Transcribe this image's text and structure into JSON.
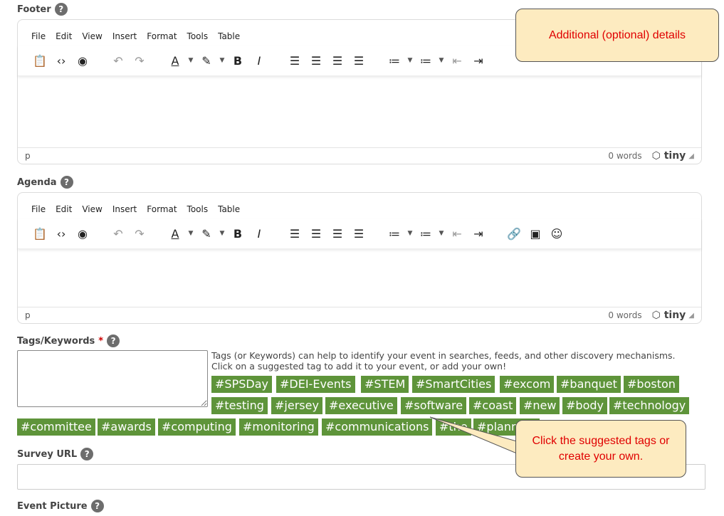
{
  "footer": {
    "label": "Footer",
    "help": "?"
  },
  "agenda": {
    "label": "Agenda",
    "help": "?"
  },
  "editor": {
    "menus": [
      "File",
      "Edit",
      "View",
      "Insert",
      "Format",
      "Tools",
      "Table"
    ],
    "path": "p",
    "word_count": "0 words",
    "brand": "tiny"
  },
  "tags": {
    "label": "Tags/Keywords",
    "required_mark": "*",
    "help": "?",
    "help_line1": "Tags (or Keywords) can help to identify your event in searches, feeds, and other discovery mechanisms.",
    "help_line2": "Click on a suggested tag to add it to your event, or add your own!",
    "suggested": [
      "#SPSDay",
      "#DEI-Events",
      "#STEM",
      "#SmartCities",
      "#excom",
      "#banquet",
      "#boston",
      "#testing",
      "#jersey",
      "#executive",
      "#software",
      "#coast",
      "#new",
      "#body",
      "#technology",
      "#committee",
      "#awards",
      "#computing",
      "#monitoring",
      "#communications",
      "#the",
      "#planning"
    ]
  },
  "survey": {
    "label": "Survey URL",
    "help": "?",
    "value": ""
  },
  "picture": {
    "label": "Event Picture",
    "help": "?"
  },
  "callouts": {
    "details": "Additional (optional) details",
    "tags_line1": "Click the suggested tags or",
    "tags_line2": "create your own."
  },
  "colors": {
    "tag_bg": "#5e943a",
    "callout_bg": "#fdebc0",
    "callout_text": "#e00000"
  }
}
